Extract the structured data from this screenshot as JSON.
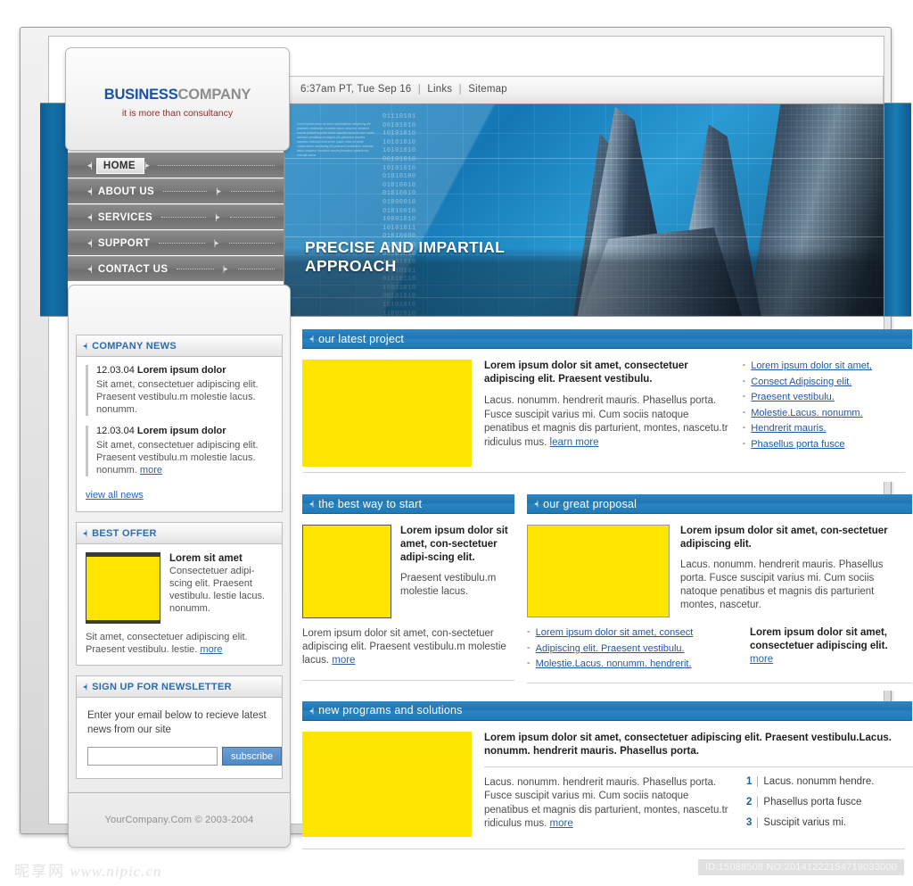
{
  "topbar": {
    "datetime": "6:37am PT, Tue Sep 16",
    "sep": "|",
    "links_label": "Links",
    "sitemap_label": "Sitemap"
  },
  "logo": {
    "part_a": "BUSINESS",
    "part_b": "COMPANY",
    "tagline": "it is more than consultancy"
  },
  "nav": {
    "items": [
      {
        "label": "HOME",
        "active": true
      },
      {
        "label": "ABOUT US",
        "active": false
      },
      {
        "label": "SERVICES",
        "active": false
      },
      {
        "label": "SUPPORT",
        "active": false
      },
      {
        "label": "CONTACT US",
        "active": false
      }
    ]
  },
  "banner": {
    "title_line1": "PRECISE AND IMPARTIAL",
    "title_line2": "APPROACH",
    "binary": "01110101\n00101010\n10101010\n10101010\n10101010\n00101010\n10101010\n01010100\n01010010\n01010010\n01000010\n01010010\n10001010\n10101011\n01010000\n11101010\n00101010\n10101010\n01010101\n01010110\n10011010\n00101010\n10101010\n11001010",
    "microtext": "Lorem ipsum dolor sit amet consectetuer adipiscing elit praesent vestibulum molestie lacus nonumm hendrerit mauris phasellus porta fusce suscipit varius mi cum sociis natoque penatibus et magnis dis parturient montes nascetur ridiculus mus lorem ipsum dolor sit amet consectetuer adipiscing elit praesent vestibulum molestie lacus nonumm hendrerit mauris phasellus porta fusce suscipit varius"
  },
  "sidebar": {
    "news": {
      "title": "COMPANY NEWS",
      "items": [
        {
          "date": "12.03.04",
          "title": "Lorem ipsum dolor",
          "body": "Sit amet, consectetuer adipiscing elit. Praesent vestibulu.m molestie lacus. nonumm."
        },
        {
          "date": "12.03.04",
          "title": "Lorem ipsum dolor",
          "body": "Sit amet, consectetuer adipiscing elit. Praesent vestibulu.m molestie lacus. nonumm.",
          "more": "more"
        }
      ],
      "view_all": "view all news"
    },
    "offer": {
      "title": "BEST OFFER",
      "heading": "Lorem sit amet",
      "body": "Consectetuer adipi-scing elit. Praesent vestibulu. lestie lacus. nonumm.",
      "footer": "Sit amet, consectetuer adipiscing elit. Praesent vestibulu. lestie.",
      "more": "more"
    },
    "newsletter": {
      "title": "SIGN UP FOR NEWSLETTER",
      "text": "Enter your email below to recieve latest news from our site",
      "input_value": "",
      "input_placeholder": "",
      "button_label": "subscribe"
    },
    "copyright": "YourCompany.Com © 2003-2004"
  },
  "main": {
    "latest_project": {
      "title": "our latest project",
      "heading": "Lorem ipsum dolor sit amet, consectetuer adipiscing elit. Praesent vestibulu.",
      "paragraph": "Lacus. nonumm. hendrerit mauris. Phasellus porta. Fusce suscipit varius mi. Cum sociis natoque penatibus et magnis dis parturient, montes, nascetu.tr ridiculus mus.",
      "more": "learn more",
      "links": [
        "Lorem ipsum dolor sit amet,",
        "Consect Adipiscing elit.",
        "Praesent vestibulu.",
        "Molestie.Lacus. nonumm.",
        "Hendrerit mauris.",
        "Phasellus porta fusce"
      ]
    },
    "best_way": {
      "title": "the best way to start",
      "heading": "Lorem ipsum dolor sit amet, con-sectetuer adipi-scing elit.",
      "paragraph": "Praesent vestibulu.m molestie lacus.",
      "footer": "Lorem ipsum dolor sit amet, con-sectetuer adipiscing elit. Praesent vestibulu.m molestie lacus.",
      "more": "more"
    },
    "great_proposal": {
      "title": "our great proposal",
      "heading": "Lorem ipsum dolor sit amet, con-sectetuer adipiscing elit.",
      "paragraph": "Lacus. nonumm. hendrerit mauris. Phasellus porta. Fusce suscipit varius mi. Cum sociis natoque penatibus et magnis dis parturient montes, nascetur.",
      "links": [
        "Lorem ipsum dolor sit amet, consect",
        "Adipiscing elit. Praesent vestibulu.",
        "Molestie.Lacus. nonumm. hendrerit."
      ],
      "side_text": "Lorem ipsum dolor sit amet, consectetuer adipiscing elit.",
      "more": "more"
    },
    "new_programs": {
      "title": "new programs and solutions",
      "heading": "Lorem ipsum dolor sit amet, consectetuer adipiscing elit. Praesent vestibulu.Lacus. nonumm. hendrerit mauris. Phasellus porta.",
      "paragraph": "Lacus. nonumm. hendrerit mauris. Phasellus porta. Fusce suscipit varius mi. Cum sociis natoque penatibus et magnis dis parturient, montes, nascetu.tr ridiculus mus.",
      "more": "more",
      "numbered": [
        {
          "num": "1",
          "text": "Lacus. nonumm hendre."
        },
        {
          "num": "2",
          "text": "Phasellus porta fusce"
        },
        {
          "num": "3",
          "text": "Suscipit varius mi."
        }
      ]
    }
  },
  "watermark": {
    "left_cn": "昵享网",
    "left_url": "www.nipic.cn",
    "right": "ID:15088508 NO:20141222154719033000"
  },
  "colors": {
    "accent_blue": "#1d76b5",
    "logo_blue": "#1b50a5",
    "link_blue": "#2257a6",
    "image_placeholder": "#ffe400"
  }
}
